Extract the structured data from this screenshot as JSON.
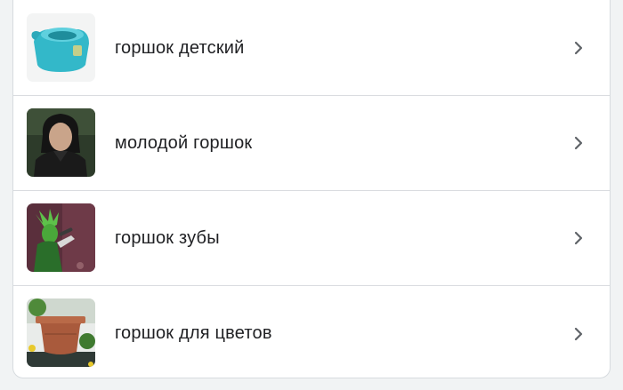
{
  "suggestions": [
    {
      "label": "горшок детский",
      "image": "baby-potty-thumbnail",
      "icon": "chevron-right-icon"
    },
    {
      "label": "молодой горшок",
      "image": "young-man-portrait-thumbnail",
      "icon": "chevron-right-icon"
    },
    {
      "label": "горшок зубы",
      "image": "punk-singer-green-hair-thumbnail",
      "icon": "chevron-right-icon"
    },
    {
      "label": "горшок для цветов",
      "image": "flower-pot-thumbnail",
      "icon": "chevron-right-icon"
    }
  ],
  "colors": {
    "background": "#f1f3f4",
    "card": "#ffffff",
    "divider": "#dadce0",
    "text": "#202124",
    "chevron": "#5f6368"
  }
}
